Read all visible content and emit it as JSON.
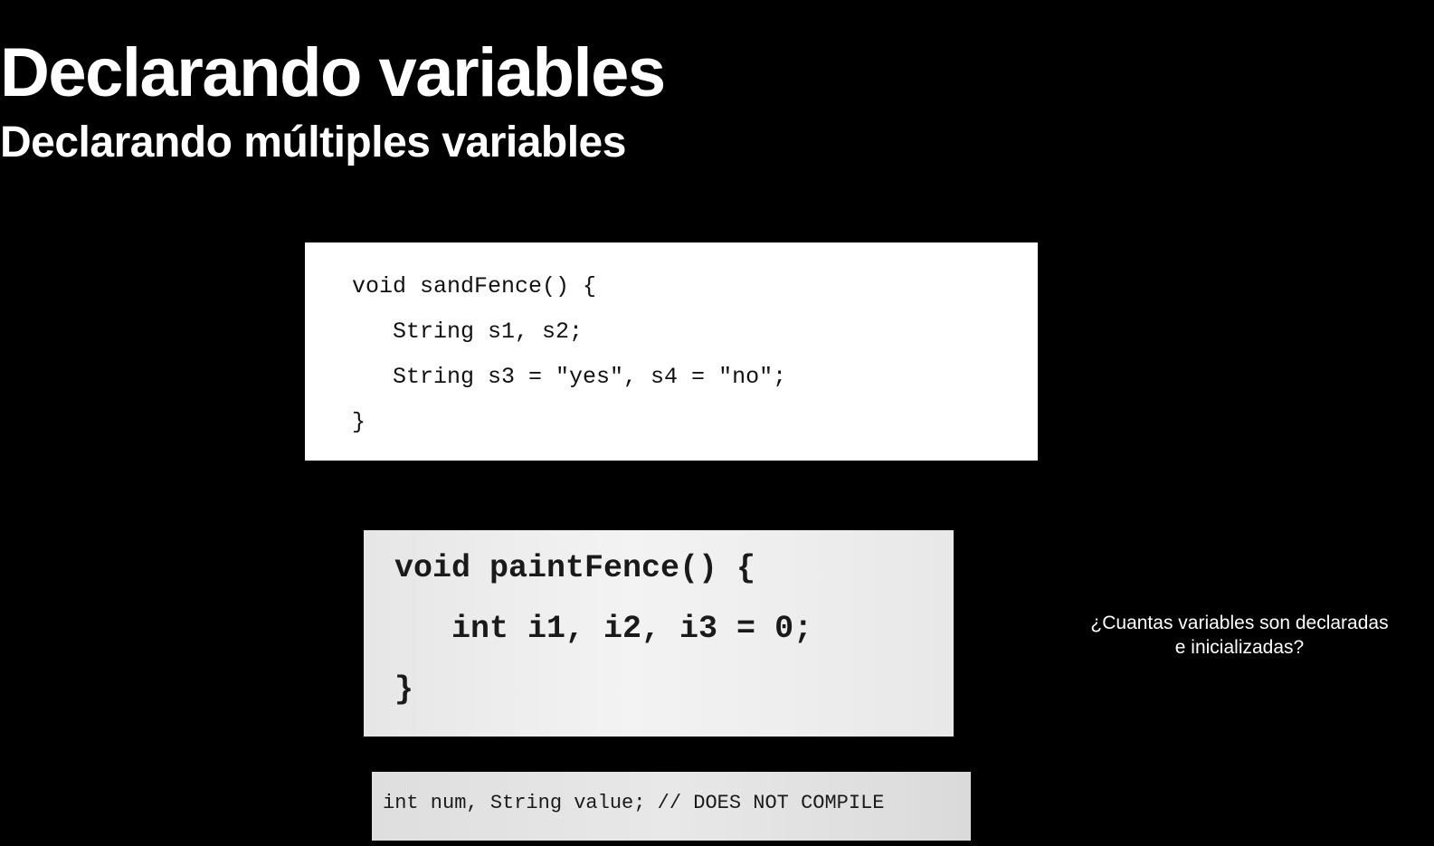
{
  "slide": {
    "title": "Declarando variables",
    "subtitle": "Declarando múltiples variables",
    "question_lines": [
      "¿Cuantas variables son declaradas",
      "e inicializadas?"
    ]
  },
  "code_blocks": [
    {
      "lines": [
        "void sandFence() {",
        "   String s1, s2;",
        "   String s3 = \"yes\", s4 = \"no\";",
        "}"
      ]
    },
    {
      "lines": [
        "void paintFence() {",
        "   int i1, i2, i3 = 0;",
        "}"
      ]
    },
    {
      "lines": [
        "int num, String value; // DOES NOT COMPILE"
      ]
    }
  ],
  "colors": {
    "background": "#000000",
    "text": "#ffffff",
    "code_box_1": "#ffffff",
    "code_box_2": "#ececec",
    "code_box_3": "#e2e2e2",
    "code_text": "#111111"
  }
}
